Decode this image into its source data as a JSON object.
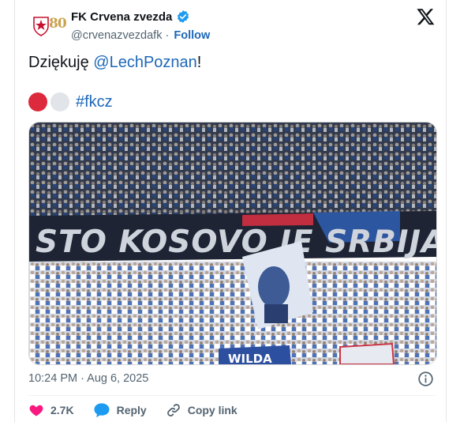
{
  "author": {
    "display_name": "FK Crvena zvezda",
    "handle": "@crvenazvezdafk",
    "separator": "·",
    "follow_label": "Follow",
    "avatar_text": "80"
  },
  "tweet": {
    "text_before": "Dziękuję ",
    "mention": "@LechPoznan",
    "text_after": "!",
    "hashtag": "#fkcz",
    "emoji_dots": [
      "#dc2a3c",
      "#e1e4e8"
    ],
    "timestamp": "10:24 PM · Aug 6, 2025"
  },
  "photo": {
    "banner_text": "STO KOSOVO JE SRBIJA OV",
    "sign_text": "WILDA"
  },
  "actions": {
    "like_count": "2.7K",
    "reply_label": "Reply",
    "copy_label": "Copy link"
  },
  "colors": {
    "link": "#1d67b8",
    "like": "#f91880",
    "reply": "#1d9bf0",
    "verified": "#1d9bf0"
  }
}
